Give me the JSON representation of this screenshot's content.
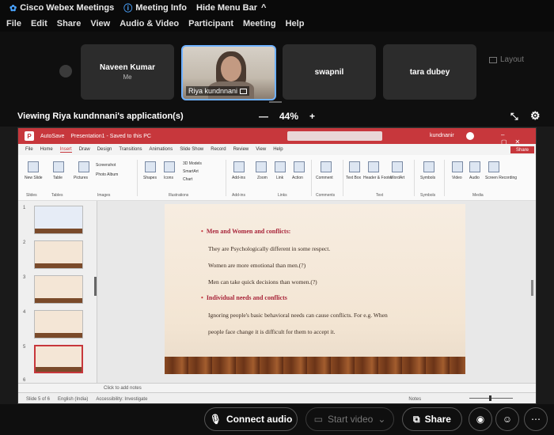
{
  "titlebar": {
    "app_name": "Cisco Webex Meetings",
    "meeting_info": "Meeting Info",
    "hide_menu": "Hide Menu Bar",
    "hide_menu_chevron": "^"
  },
  "menu": [
    "File",
    "Edit",
    "Share",
    "View",
    "Audio & Video",
    "Participant",
    "Meeting",
    "Help"
  ],
  "participants": [
    {
      "name": "Naveen Kumar",
      "sub": "Me"
    },
    {
      "name": "Riya kundnnani"
    },
    {
      "name": "swapnil"
    },
    {
      "name": "tara dubey"
    }
  ],
  "layout_label": "Layout",
  "viewing_text": "Viewing Riya kundnnani's application(s)",
  "zoom": {
    "minus": "—",
    "value": "44%",
    "plus": "+"
  },
  "ppt": {
    "title_left": "AutoSave",
    "title_doc": "Presentation1 - Saved to this PC",
    "user": "kundnanir",
    "share": "Share",
    "tabs": [
      "File",
      "Home",
      "Insert",
      "Draw",
      "Design",
      "Transitions",
      "Animations",
      "Slide Show",
      "Record",
      "Review",
      "View",
      "Help"
    ],
    "ribbon_labels": [
      "New Slide",
      "Table",
      "Pictures",
      "Screenshot",
      "Photo Album",
      "Shapes",
      "Icons",
      "3D Models",
      "SmartArt",
      "Chart",
      "Add-ins",
      "Zoom",
      "Link",
      "Action",
      "Comment",
      "Text Box",
      "Header & Footer",
      "WordArt",
      "Symbols",
      "Video",
      "Audio",
      "Screen Recording"
    ],
    "ribbon_groups": [
      "Slides",
      "Tables",
      "Images",
      "Illustrations",
      "Add-ins",
      "Links",
      "Comments",
      "Text",
      "Symbols",
      "Media"
    ],
    "slide_numbers": [
      "1",
      "2",
      "3",
      "4",
      "5",
      "6"
    ],
    "notes_placeholder": "Click to add notes",
    "status": [
      "Slide 5 of 6",
      "English (India)",
      "Accessibility: Investigate"
    ],
    "status_right": "Notes",
    "slide": {
      "heading1": "Men and Women and conflicts:",
      "line1": "They are Psychologically different in some respect.",
      "line2": "Women are more emotional than men.(?)",
      "line3": "Men can take quick decisions than women.(?)",
      "heading2": "Individual needs and conflicts",
      "line4": "Ignoring people's basic behavioral needs can cause conflicts. For e.g. When",
      "line5": "people face change it is difficult for them to accept it."
    }
  },
  "controls": {
    "connect_audio": "Connect audio",
    "start_video": "Start video",
    "share": "Share"
  }
}
